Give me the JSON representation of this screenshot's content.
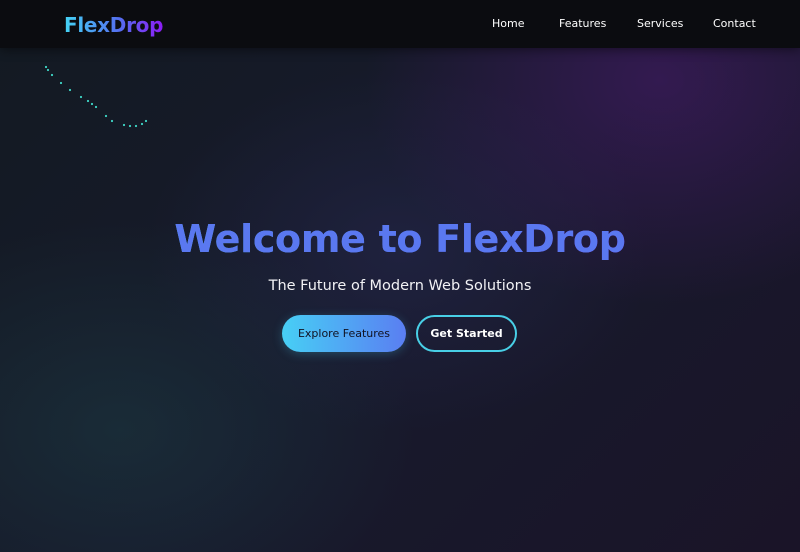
{
  "brand": {
    "logo_text": "FlexDrop",
    "gradient_colors": [
      "#44d4f5",
      "#5470f0",
      "#8c1cf5"
    ]
  },
  "nav": {
    "items": [
      {
        "id": "home",
        "label": "Home"
      },
      {
        "id": "features",
        "label": "Features"
      },
      {
        "id": "services",
        "label": "Services"
      },
      {
        "id": "contact",
        "label": "Contact"
      }
    ]
  },
  "hero": {
    "title": "Welcome to FlexDrop",
    "subtitle": "The Future of Modern Web Solutions",
    "primary_button": "Explore Features",
    "secondary_button": "Get Started"
  },
  "colors": {
    "accent_cyan": "#47cff5",
    "accent_blue": "#5a7ef2",
    "accent_purple": "#8c1cf5",
    "navbar_bg": "#0b0c10",
    "particle_color": "#3fd6c6"
  }
}
